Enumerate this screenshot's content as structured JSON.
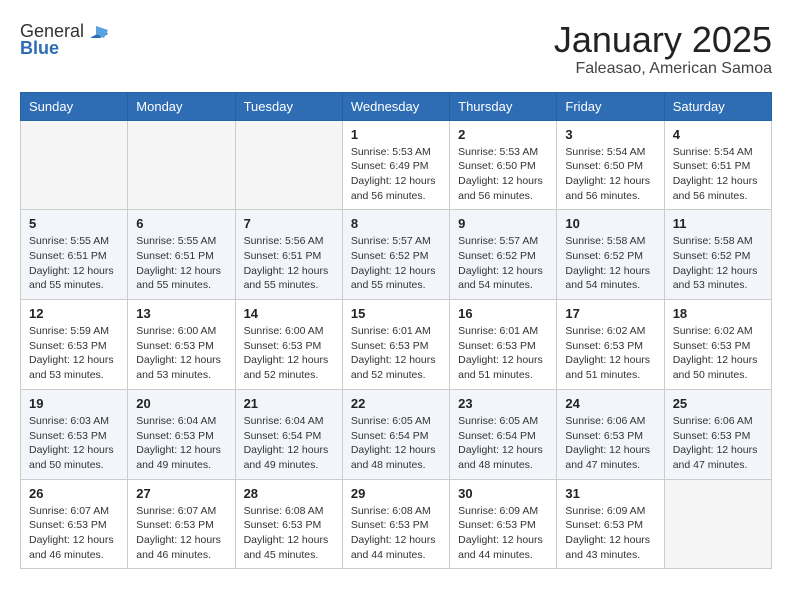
{
  "logo": {
    "general": "General",
    "blue": "Blue",
    "tagline": "GeneralBlue"
  },
  "header": {
    "month": "January 2025",
    "location": "Faleasao, American Samoa"
  },
  "weekdays": [
    "Sunday",
    "Monday",
    "Tuesday",
    "Wednesday",
    "Thursday",
    "Friday",
    "Saturday"
  ],
  "weeks": [
    [
      {
        "day": "",
        "info": ""
      },
      {
        "day": "",
        "info": ""
      },
      {
        "day": "",
        "info": ""
      },
      {
        "day": "1",
        "info": "Sunrise: 5:53 AM\nSunset: 6:49 PM\nDaylight: 12 hours and 56 minutes."
      },
      {
        "day": "2",
        "info": "Sunrise: 5:53 AM\nSunset: 6:50 PM\nDaylight: 12 hours and 56 minutes."
      },
      {
        "day": "3",
        "info": "Sunrise: 5:54 AM\nSunset: 6:50 PM\nDaylight: 12 hours and 56 minutes."
      },
      {
        "day": "4",
        "info": "Sunrise: 5:54 AM\nSunset: 6:51 PM\nDaylight: 12 hours and 56 minutes."
      }
    ],
    [
      {
        "day": "5",
        "info": "Sunrise: 5:55 AM\nSunset: 6:51 PM\nDaylight: 12 hours and 55 minutes."
      },
      {
        "day": "6",
        "info": "Sunrise: 5:55 AM\nSunset: 6:51 PM\nDaylight: 12 hours and 55 minutes."
      },
      {
        "day": "7",
        "info": "Sunrise: 5:56 AM\nSunset: 6:51 PM\nDaylight: 12 hours and 55 minutes."
      },
      {
        "day": "8",
        "info": "Sunrise: 5:57 AM\nSunset: 6:52 PM\nDaylight: 12 hours and 55 minutes."
      },
      {
        "day": "9",
        "info": "Sunrise: 5:57 AM\nSunset: 6:52 PM\nDaylight: 12 hours and 54 minutes."
      },
      {
        "day": "10",
        "info": "Sunrise: 5:58 AM\nSunset: 6:52 PM\nDaylight: 12 hours and 54 minutes."
      },
      {
        "day": "11",
        "info": "Sunrise: 5:58 AM\nSunset: 6:52 PM\nDaylight: 12 hours and 53 minutes."
      }
    ],
    [
      {
        "day": "12",
        "info": "Sunrise: 5:59 AM\nSunset: 6:53 PM\nDaylight: 12 hours and 53 minutes."
      },
      {
        "day": "13",
        "info": "Sunrise: 6:00 AM\nSunset: 6:53 PM\nDaylight: 12 hours and 53 minutes."
      },
      {
        "day": "14",
        "info": "Sunrise: 6:00 AM\nSunset: 6:53 PM\nDaylight: 12 hours and 52 minutes."
      },
      {
        "day": "15",
        "info": "Sunrise: 6:01 AM\nSunset: 6:53 PM\nDaylight: 12 hours and 52 minutes."
      },
      {
        "day": "16",
        "info": "Sunrise: 6:01 AM\nSunset: 6:53 PM\nDaylight: 12 hours and 51 minutes."
      },
      {
        "day": "17",
        "info": "Sunrise: 6:02 AM\nSunset: 6:53 PM\nDaylight: 12 hours and 51 minutes."
      },
      {
        "day": "18",
        "info": "Sunrise: 6:02 AM\nSunset: 6:53 PM\nDaylight: 12 hours and 50 minutes."
      }
    ],
    [
      {
        "day": "19",
        "info": "Sunrise: 6:03 AM\nSunset: 6:53 PM\nDaylight: 12 hours and 50 minutes."
      },
      {
        "day": "20",
        "info": "Sunrise: 6:04 AM\nSunset: 6:53 PM\nDaylight: 12 hours and 49 minutes."
      },
      {
        "day": "21",
        "info": "Sunrise: 6:04 AM\nSunset: 6:54 PM\nDaylight: 12 hours and 49 minutes."
      },
      {
        "day": "22",
        "info": "Sunrise: 6:05 AM\nSunset: 6:54 PM\nDaylight: 12 hours and 48 minutes."
      },
      {
        "day": "23",
        "info": "Sunrise: 6:05 AM\nSunset: 6:54 PM\nDaylight: 12 hours and 48 minutes."
      },
      {
        "day": "24",
        "info": "Sunrise: 6:06 AM\nSunset: 6:53 PM\nDaylight: 12 hours and 47 minutes."
      },
      {
        "day": "25",
        "info": "Sunrise: 6:06 AM\nSunset: 6:53 PM\nDaylight: 12 hours and 47 minutes."
      }
    ],
    [
      {
        "day": "26",
        "info": "Sunrise: 6:07 AM\nSunset: 6:53 PM\nDaylight: 12 hours and 46 minutes."
      },
      {
        "day": "27",
        "info": "Sunrise: 6:07 AM\nSunset: 6:53 PM\nDaylight: 12 hours and 46 minutes."
      },
      {
        "day": "28",
        "info": "Sunrise: 6:08 AM\nSunset: 6:53 PM\nDaylight: 12 hours and 45 minutes."
      },
      {
        "day": "29",
        "info": "Sunrise: 6:08 AM\nSunset: 6:53 PM\nDaylight: 12 hours and 44 minutes."
      },
      {
        "day": "30",
        "info": "Sunrise: 6:09 AM\nSunset: 6:53 PM\nDaylight: 12 hours and 44 minutes."
      },
      {
        "day": "31",
        "info": "Sunrise: 6:09 AM\nSunset: 6:53 PM\nDaylight: 12 hours and 43 minutes."
      },
      {
        "day": "",
        "info": ""
      }
    ]
  ]
}
